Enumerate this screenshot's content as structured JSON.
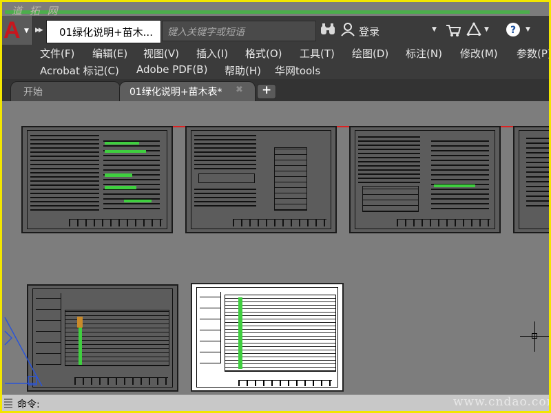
{
  "watermarks": {
    "top": "道 拓 网",
    "bottom": "www.cndao.com"
  },
  "titlebar": {
    "document_tab": "01绿化说明+苗木...",
    "search_placeholder": "键入关键字或短语",
    "login_label": "登录"
  },
  "menubar": {
    "row1": [
      "文件(F)",
      "编辑(E)",
      "视图(V)",
      "插入(I)",
      "格式(O)",
      "工具(T)",
      "绘图(D)",
      "标注(N)",
      "修改(M)",
      "参数(P)"
    ],
    "row2": [
      "Acrobat 标记(C)",
      "Adobe PDF(B)",
      "帮助(H)",
      "华网tools"
    ]
  },
  "file_tabs": [
    {
      "label": "开始"
    },
    {
      "label": "01绿化说明+苗木表*"
    }
  ],
  "command_line": {
    "prompt": "命令:"
  },
  "colors": {
    "accent_green": "#4cae4c",
    "frame_yellow": "#f2e600",
    "autocad_red": "#c8161d"
  },
  "icons": [
    "app-logo-icon",
    "binoculars-icon",
    "user-icon",
    "cart-icon",
    "triangle-network-icon",
    "help-icon",
    "close-icon",
    "plus-icon",
    "crosshair-icon",
    "ucs-icon"
  ]
}
